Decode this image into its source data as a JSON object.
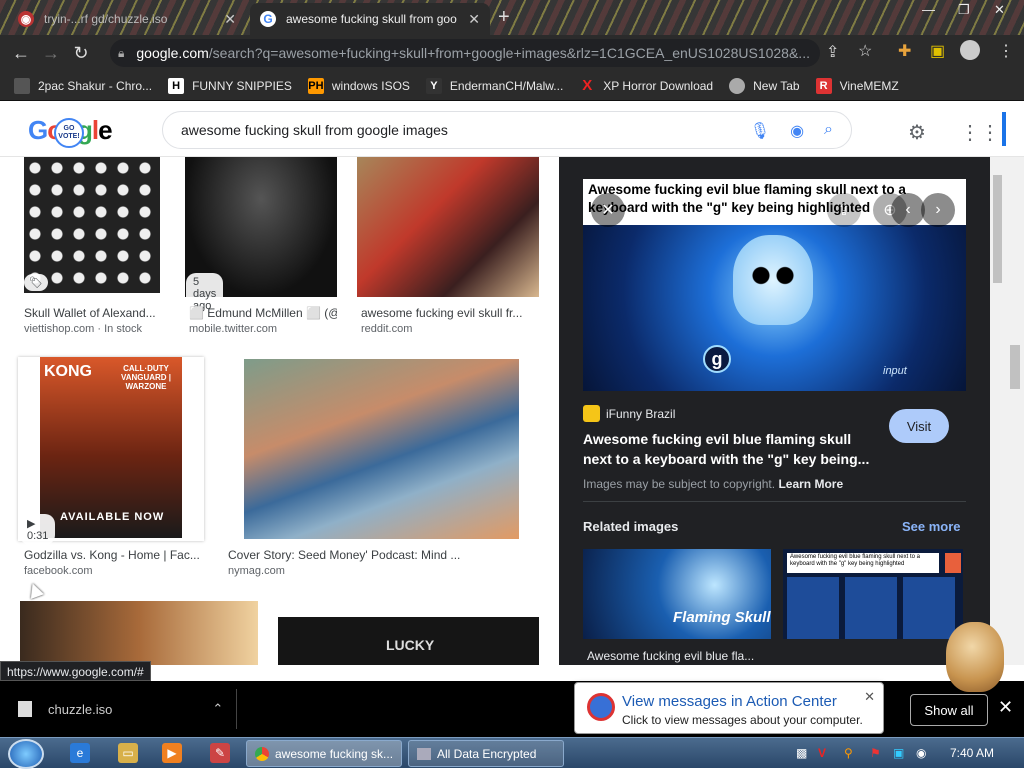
{
  "tabs": [
    {
      "title": "tryin-...rf gd/chuzzle.iso"
    },
    {
      "title": "awesome fucking skull from goo"
    }
  ],
  "omnibox": {
    "domain": "google.com",
    "path": "/search?q=awesome+fucking+skull+from+google+images&rlz=1C1GCEA_enUS1028US1028&..."
  },
  "bookmarks": [
    "2pac Shakur - Chro...",
    "FUNNY SNIPPIES",
    "windows ISOS",
    "EndermanCH/Malw...",
    "XP Horror Download",
    "New Tab",
    "VineMEMZ"
  ],
  "bookmark_icon_text": [
    "",
    "H",
    "PH",
    "Y",
    "X",
    "",
    ""
  ],
  "google": {
    "logo_letters": [
      "G",
      "o",
      "o",
      "g",
      "l",
      "e"
    ],
    "badge": "GO VOTE!",
    "query": "awesome fucking skull from google images"
  },
  "results": [
    {
      "caption": "Skull Wallet of Alexand...",
      "source": "viettishop.com · In stock"
    },
    {
      "caption": "⬜ Edmund McMillen ⬜ (@...",
      "source": "mobile.twitter.com",
      "badge": "5 days ago"
    },
    {
      "caption": "awesome fucking evil skull fr...",
      "source": "reddit.com"
    },
    {
      "caption": "Godzilla vs. Kong - Home | Fac...",
      "source": "facebook.com",
      "badge": "▶ 0:31"
    },
    {
      "caption": "Cover Story: Seed Money' Podcast: Mind ...",
      "source": "nymag.com"
    }
  ],
  "thumb_text": {
    "kong": "KONG",
    "cod": "CALL·DUTY VANGUARD | WARZONE",
    "available": "AVAILABLE NOW",
    "lucky": "LUCKY"
  },
  "preview": {
    "image_title": "Awesome fucking evil blue flaming skull next to a keyboard with the \"g\" key being highlighted",
    "source": "iFunny Brazil",
    "visit": "Visit",
    "title": "Awesome fucking evil blue flaming skull next to a keyboard with the \"g\" key being...",
    "copyright": "Images may be subject to copyright.",
    "learn_more": "Learn More",
    "related": "Related images",
    "see_more": "See more",
    "related_caption": "Awesome fucking evil blue fla...",
    "related_overlay": "Flaming Skull",
    "related_small": "Awesome fucking evil blue flaming skull next to a keyboard with the \"g\" key being highlighted",
    "key_g": "g",
    "key_input": "input"
  },
  "status_url": "https://www.google.com/#",
  "download": {
    "file": "chuzzle.iso",
    "show_all": "Show all"
  },
  "toast": {
    "title": "View messages in Action Center",
    "subtitle": "Click to view messages about your computer."
  },
  "taskbar": {
    "buttons": [
      "awesome fucking sk...",
      "All Data Encrypted"
    ],
    "clock": "7:40 AM"
  },
  "colors": {
    "chrome_dark": "#2b2b2b",
    "panel_dark": "#202124",
    "link_blue": "#8ab4f8",
    "visit_btn": "#aecbfa",
    "taskbar": "#2a4769"
  }
}
